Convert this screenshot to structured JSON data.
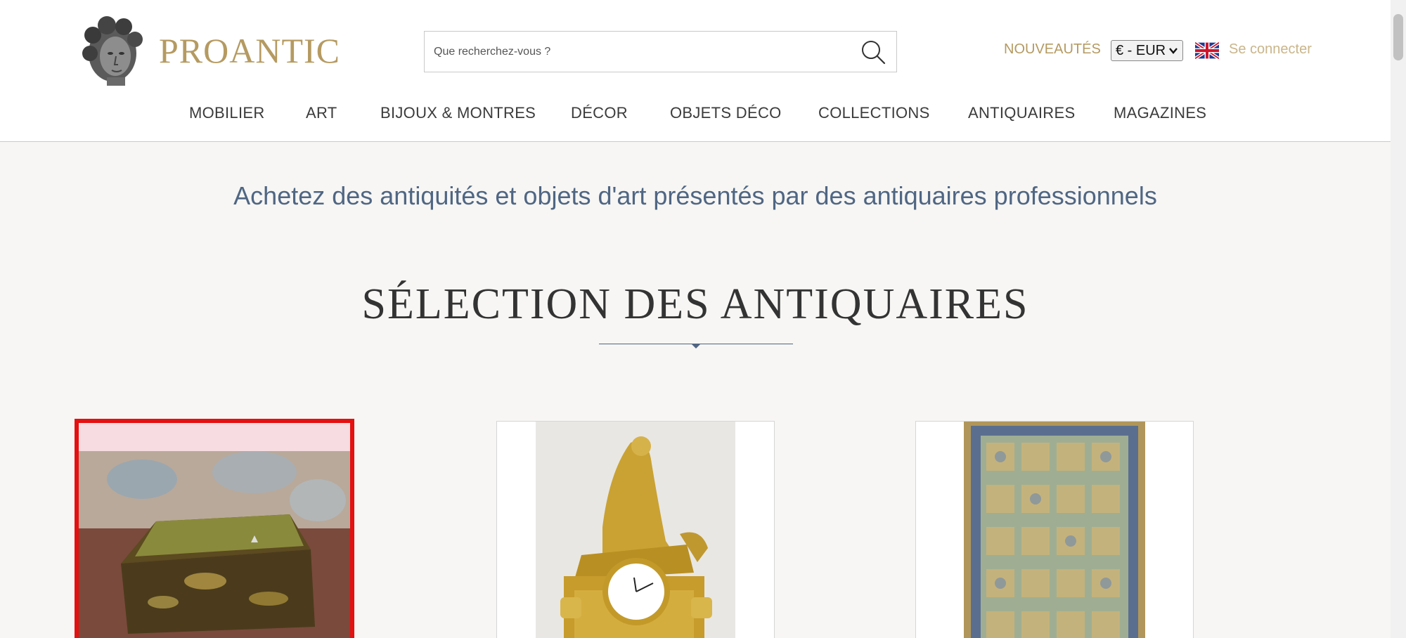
{
  "brand": {
    "name": "PROANTIC",
    "logo_icon": "sculpted-head-logo"
  },
  "search": {
    "placeholder": "Que recherchez-vous ?",
    "value": "",
    "icon": "search-icon"
  },
  "header_links": {
    "new_arrivals": "NOUVEAUTÉS",
    "currency": "€ - EUR",
    "language_flag": "uk-flag-icon",
    "login": "Se connecter"
  },
  "nav": [
    {
      "label": "MOBILIER"
    },
    {
      "label": "ART"
    },
    {
      "label": "BIJOUX & MONTRES"
    },
    {
      "label": "DÉCOR"
    },
    {
      "label": "OBJETS DÉCO"
    },
    {
      "label": "COLLECTIONS"
    },
    {
      "label": "ANTIQUAIRES"
    },
    {
      "label": "MAGAZINES"
    }
  ],
  "tagline": "Achetez des antiquités et objets d'art présentés par des antiquaires professionnels",
  "section_title": "SÉLECTION DES ANTIQUAIRES",
  "colors": {
    "brand_gold": "#b59a61",
    "nav_text": "#3b3b3b",
    "tagline_blue": "#4f6683",
    "selection_red": "#e51010",
    "page_bg": "#f7f6f4"
  },
  "products": [
    {
      "name": "lacquered-chinoiserie-box",
      "selected": true
    },
    {
      "name": "gilt-bronze-mantel-clock",
      "selected": false
    },
    {
      "name": "persian-garden-carpet",
      "selected": false
    }
  ]
}
